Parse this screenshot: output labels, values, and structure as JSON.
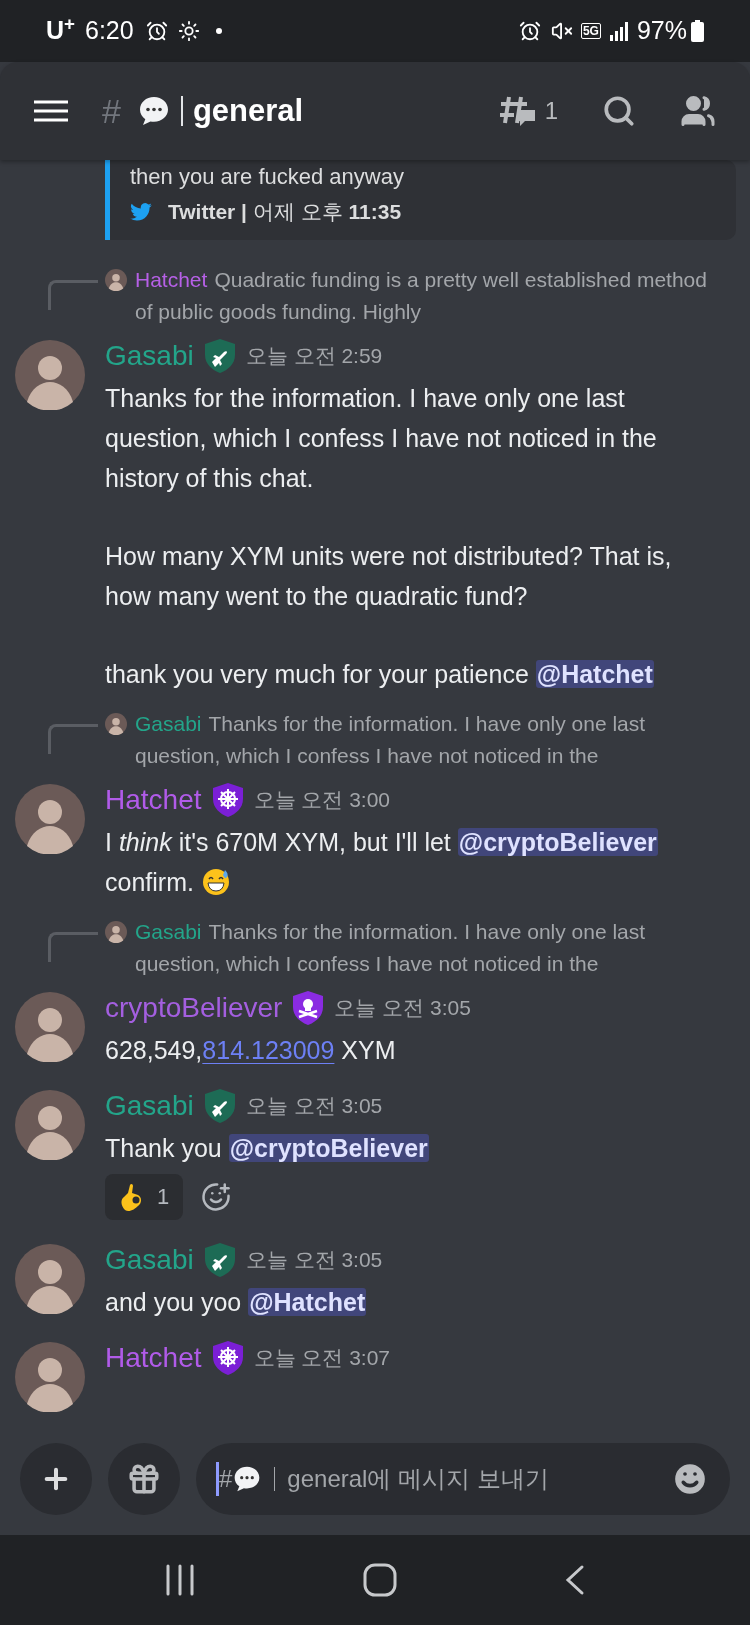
{
  "status_bar": {
    "carrier": "U$^{+}$",
    "time": "6:20",
    "network": "5G",
    "battery": "97%"
  },
  "header": {
    "prefix": "#",
    "channel": "general",
    "thread_count": "1"
  },
  "embed": {
    "text": "then you are fucked anyway",
    "footer": "**Twitter |** 어제 오후 **11:35**"
  },
  "messages": [
    {
      "reply": {
        "author": "Hatchet",
        "color": "#b660e6",
        "text": "Quadratic funding is a pretty well established method of public goods funding. Highly"
      },
      "author": "Gasabi",
      "color": "#23a58a",
      "badge": {
        "kind": "plane"
      },
      "time": "오늘 오전 2:59",
      "paragraphs": [
        [
          {
            "kind": "text",
            "text": "Thanks for the information. I have only one last question, which I confess I have not noticed in the history of this chat."
          }
        ],
        [
          {
            "kind": "text",
            "text": "How many XYM units were not distributed? That is, how many went to the quadratic fund?"
          }
        ],
        [
          {
            "kind": "text",
            "text": "thank you very much for your patience "
          },
          {
            "kind": "mention",
            "text": "@Hatchet"
          }
        ]
      ]
    },
    {
      "reply": {
        "author": "Gasabi",
        "color": "#23a58a",
        "text": "Thanks for the information. I have only one last question, which I confess I have not noticed in the"
      },
      "author": "Hatchet",
      "color": "#b15be9",
      "badge": {
        "kind": "wheel"
      },
      "time": "오늘 오전 3:00",
      "paragraphs": [
        [
          {
            "kind": "text",
            "text": "I *think* it's 670M XYM, but I'll let "
          },
          {
            "kind": "mention",
            "text": "@cryptoBeliever"
          },
          {
            "kind": "text",
            "text": " confirm. "
          },
          {
            "kind": "emoji"
          }
        ]
      ]
    },
    {
      "reply": {
        "author": "Gasabi",
        "color": "#23a58a",
        "text": "Thanks for the information. I have only one last question, which I confess I have not noticed in the"
      },
      "author": "cryptoBeliever",
      "color": "#a45fe0",
      "badge": {
        "kind": "skull"
      },
      "time": "오늘 오전 3:05",
      "paragraphs": [
        [
          {
            "kind": "text",
            "text": "628,549,"
          },
          {
            "kind": "link",
            "text": "814.123009"
          },
          {
            "kind": "text",
            "text": " XYM"
          }
        ]
      ]
    },
    {
      "author": "Gasabi",
      "color": "#23a58a",
      "badge": {
        "kind": "plane"
      },
      "time": "오늘 오전 3:05",
      "paragraphs": [
        [
          {
            "kind": "text",
            "text": "Thank you "
          },
          {
            "kind": "mention",
            "text": "@cryptoBeliever"
          }
        ]
      ],
      "reaction": {
        "count": "1"
      }
    },
    {
      "author": "Gasabi",
      "color": "#23a58a",
      "badge": {
        "kind": "plane"
      },
      "time": "오늘 오전 3:05",
      "paragraphs": [
        [
          {
            "kind": "text",
            "text": "and you yoo "
          },
          {
            "kind": "mention",
            "text": "@Hatchet"
          }
        ]
      ]
    },
    {
      "author": "Hatchet",
      "color": "#b15be9",
      "badge": {
        "kind": "wheel"
      },
      "time": "오늘 오전 3:07"
    }
  ],
  "composer": {
    "prefix": "#",
    "placeholder": "general에 메시지 보내기"
  }
}
